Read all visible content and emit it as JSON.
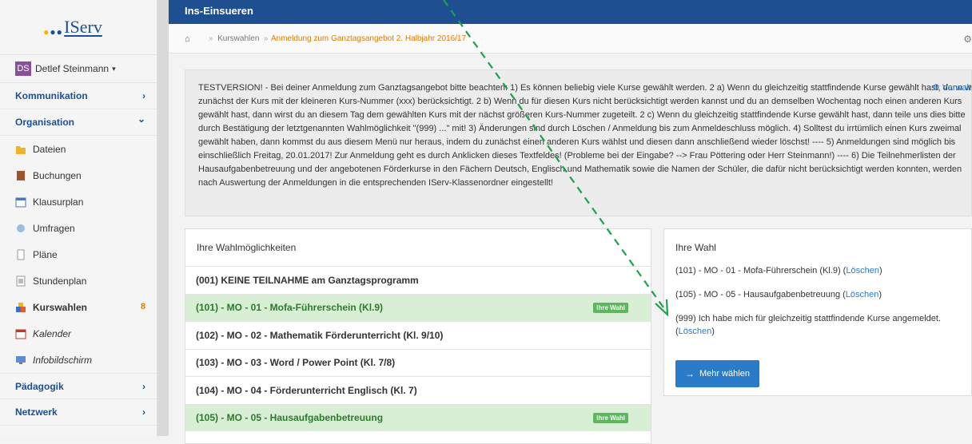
{
  "logo": {
    "text": "IServ"
  },
  "user": {
    "initials": "DS",
    "name": "Detlef Steinmann",
    "caret": "▾"
  },
  "sidebar": {
    "sections": [
      {
        "label": "Kommunikation",
        "chev": "›"
      },
      {
        "label": "Organisation",
        "chev": "⌄"
      }
    ],
    "items": [
      {
        "label": "Dateien"
      },
      {
        "label": "Buchungen"
      },
      {
        "label": "Klausurplan"
      },
      {
        "label": "Umfragen"
      },
      {
        "label": "Pläne"
      },
      {
        "label": "Stundenplan"
      },
      {
        "label": "Kurswahlen",
        "badge": "8"
      },
      {
        "label": "Kalender"
      },
      {
        "label": "Infobildschirm"
      }
    ],
    "bottom": [
      {
        "label": "Pädagogik",
        "chev": "›"
      },
      {
        "label": "Netzwerk",
        "chev": "›"
      }
    ]
  },
  "topbar": {
    "title": "Ins-Einsueren"
  },
  "breadcrumb": {
    "home": "⌂",
    "item1": "Kurswahlen",
    "sep": "»",
    "item2": "Anmeldung zum Ganztagsangebot 2. Halbjahr 2016/17",
    "gear": "⚙"
  },
  "info": {
    "text": "TESTVERSION! - Bei deiner Anmeldung zum Ganztagsangebot bitte beachten: 1) Es können beliebig viele Kurse gewählt werden. 2 a) Wenn du gleichzeitig stattfindende Kurse gewählt hast, dann wird zunächst der Kurs mit der kleineren Kurs-Nummer (xxx) berücksichtigt. 2 b) Wenn du für diesen Kurs nicht berücksichtigt werden kannst und du an demselben Wochentag noch einen anderen Kurs gewählt hast, dann wirst du an diesem Tag dem gewählten Kurs mit der nächst größeren Kurs-Nummer zugeteilt. 2 c) Wenn du gleichzeitig stattfindende Kurse gewählt hast, dann teile uns dies bitte durch Bestätigung der letztgenannten Wahlmöglichkeit \"(999) ...\" mit! 3) Änderungen sind durch Löschen / Anmeldung bis zum Anmeldeschluss möglich. 4) Solltest du irrtümlich einen Kurs zweimal gewählt haben, dann kommst du aus diesem Menü nur heraus, indem du zunächst einen anderen Kurs wählst und diesen dann anschließend wieder löschst! ---- 5) Anmeldungen sind möglich bis einschließlich Freitag, 20.01.2017! Zur Anmeldung geht es durch Anklicken dieses Textfeldes! (Probleme bei der Eingabe? --> Frau Pöttering oder Herr Steinmann!) ---- 6) Die Teilnehmerlisten der Hausaufgabenbetreuung und der angebotenen Förderkurse in den Fächern Deutsch, Englisch und Mathematik sowie die Namen der Schüler, die dafür nicht berücksichtigt werden konnten, werden nach Auswertung der Anmeldungen in die entsprechenden IServ-Klassenordner eingestellt!",
    "verwalten": "⚙ Verwalt"
  },
  "options": {
    "title": "Ihre Wahlmöglichkeiten",
    "rows": [
      {
        "label": "(001) KEINE TEILNAHME am Ganztagsprogramm",
        "chosen": false,
        "tag": ""
      },
      {
        "label": "(101) - MO - 01 - Mofa-Führerschein (Kl.9)",
        "chosen": true,
        "tag": "Ihre Wahl"
      },
      {
        "label": "(102) - MO - 02 - Mathematik Förderunterricht (Kl. 9/10)",
        "chosen": false,
        "tag": ""
      },
      {
        "label": "(103) - MO - 03 - Word / Power Point (Kl. 7/8)",
        "chosen": false,
        "tag": ""
      },
      {
        "label": "(104) - MO - 04 - Förderunterricht Englisch (Kl. 7)",
        "chosen": false,
        "tag": ""
      },
      {
        "label": "(105) - MO - 05 - Hausaufgabenbetreuung",
        "chosen": true,
        "tag": "Ihre Wahl"
      }
    ]
  },
  "selection": {
    "title": "Ihre Wahl",
    "items": [
      {
        "text": "(101) - MO - 01 - Mofa-Führerschein (Kl.9) (",
        "link": "Löschen",
        "end": ")"
      },
      {
        "text": "(105) - MO - 05 - Hausaufgabenbetreuung (",
        "link": "Löschen",
        "end": ")"
      },
      {
        "text": "(999) Ich habe mich für gleichzeitig stattfindende Kurse angemeldet. (",
        "link": "Löschen",
        "end": ")"
      }
    ],
    "button": "Mehr wählen",
    "button_icon": "→"
  },
  "colors": {
    "brand": "#1d4f91",
    "accent": "#e07b00",
    "chosen_bg": "#d9efd5",
    "tag_green": "#5cb85c",
    "link": "#2a7bc9",
    "arrow": "#1aa34a"
  }
}
